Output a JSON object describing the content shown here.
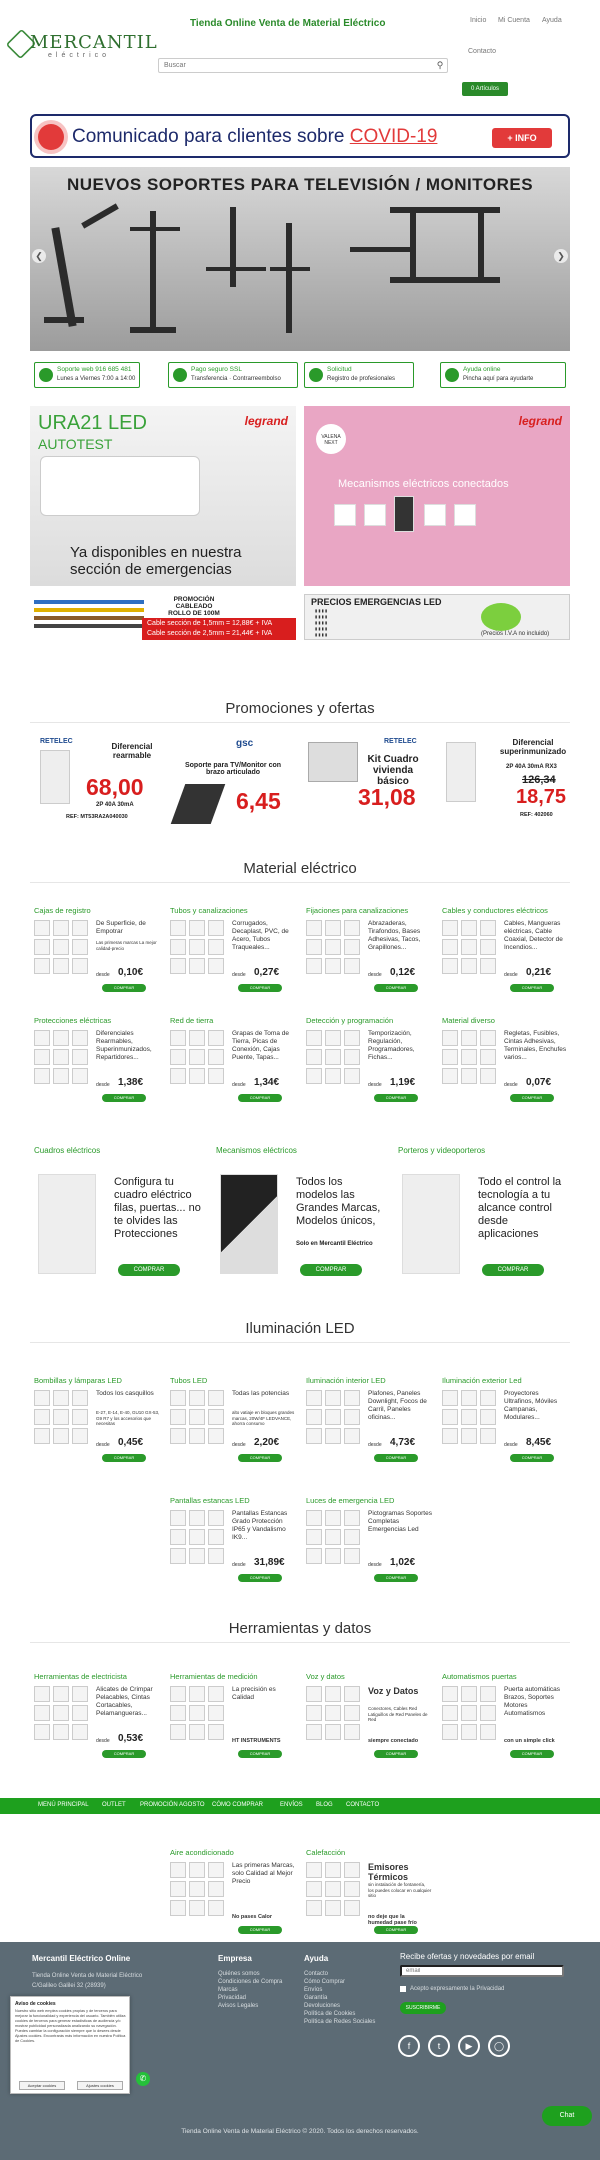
{
  "header": {
    "logo_main": "MERCANTIL",
    "logo_sub": "eléctrico",
    "tagline": "Tienda Online Venta de Material Eléctrico",
    "nav": [
      "Inicio",
      "Mi Cuenta",
      "Ayuda"
    ],
    "contact_link": "Contacto",
    "search_placeholder": "Buscar",
    "cart_label": "0 Artículos"
  },
  "covid_banner": {
    "text_a": "Comunicado para clientes sobre ",
    "text_b": "COVID-19",
    "button": "+ INFO"
  },
  "hero": {
    "title": "NUEVOS SOPORTES PARA TELEVISIÓN / MONITORES"
  },
  "features": [
    {
      "l1": "Soporte web  916 685 481",
      "l2": "Lunes a Viernes  7:00 a 14:00"
    },
    {
      "l1": "Pago seguro SSL",
      "l2": "Transferencia · Contrarreembolso"
    },
    {
      "l1": "Solicitud",
      "l2": "Registro de profesionales"
    },
    {
      "l1": "Ayuda online",
      "l2": "Pincha aquí para ayudarte"
    }
  ],
  "banners": {
    "ura": {
      "title": "URA21 LED",
      "sub": "AUTOTEST",
      "brand": "legrand",
      "bottom": "Ya disponibles en nuestra sección de emergencias"
    },
    "valena": {
      "brand": "legrand",
      "badge": "VALENA NEXT",
      "text": "Mecanismos eléctricos conectados"
    },
    "cable": {
      "title": "PROMOCIÓN CABLEADO ROLLO DE 100M",
      "line1": "Cable sección de 1,5mm = 12,88€ + IVA",
      "line2": "Cable sección de 2,5mm = 21,44€ + IVA"
    },
    "emerg": {
      "title": "PRECIOS EMERGENCIAS LED",
      "note": "(Precios I.V.A no incluido)"
    }
  },
  "sections": {
    "promos": "Promociones y ofertas",
    "material": "Material eléctrico",
    "iluminacion": "Iluminación LED",
    "herramientas": "Herramientas y datos"
  },
  "promos": [
    {
      "brand": "RETELEC",
      "head": "Diferencial rearmable",
      "price": "68,00",
      "sub": "2P 40A 30mA",
      "ref": "REF: MT53RA2A040030"
    },
    {
      "brand": "gsc",
      "head": "Soporte para TV/Monitor con brazo articulado",
      "price": "6,45"
    },
    {
      "brand": "RETELEC",
      "head": "Kit Cuadro vivienda básico",
      "price": "31,08"
    },
    {
      "brand": "",
      "head": "Diferencial superinmunizado",
      "sub": "2P 40A 30mA RX3",
      "old": "126,34",
      "price": "18,75",
      "ref": "REF: 402060"
    }
  ],
  "material": [
    {
      "title": "Cajas de registro",
      "desc": "De Superficie, de Empotrar",
      "sub": "Las primeras marcas La mejor calidad-precio",
      "price": "0,10€"
    },
    {
      "title": "Tubos y canalizaciones",
      "desc": "Corrugados, Decaplast, PVC, de Acero, Tubos Traqueales...",
      "price": "0,27€"
    },
    {
      "title": "Fijaciones para canalizaciones",
      "desc": "Abrazaderas, Tirafondos, Bases Adhesivas, Tacos, Grapillones...",
      "price": "0,12€"
    },
    {
      "title": "Cables y conductores eléctricos",
      "desc": "Cables, Mangueras eléctricas, Cable Coaxial, Detector de Incendios...",
      "price": "0,21€"
    },
    {
      "title": "Protecciones eléctricas",
      "desc": "Diferenciales Rearmables, Superinmunizados, Repartidores...",
      "price": "1,38€"
    },
    {
      "title": "Red de tierra",
      "desc": "Grapas de Toma de Tierra, Picas de Conexión, Cajas Puente, Tapas...",
      "price": "1,34€"
    },
    {
      "title": "Detección y programación",
      "desc": "Temporización, Regulación, Programadores, Fichas...",
      "price": "1,19€"
    },
    {
      "title": "Material diverso",
      "desc": "Regletas, Fusibles, Cintas Adhesivas, Terminales, Enchufes varios...",
      "price": "0,07€"
    }
  ],
  "big_cards": [
    {
      "title": "Cuadros eléctricos",
      "desc": "Configura tu cuadro eléctrico filas, puertas... no te olvides las Protecciones"
    },
    {
      "title": "Mecanismos eléctricos",
      "desc": "Todos los modelos las Grandes Marcas, Modelos únicos,",
      "note": "Solo en Mercantil Eléctrico"
    },
    {
      "title": "Porteros y videoporteros",
      "desc": "Todo el control la tecnología a tu alcance control desde aplicaciones"
    }
  ],
  "iluminacion": [
    {
      "title": "Bombillas y lámparas LED",
      "desc": "Todos los casquillos",
      "sub": "E-27, E-14, E-40, GU10 GX-53, G9 R7 y los accesorios que necesitas",
      "price": "0,45€"
    },
    {
      "title": "Tubos LED",
      "desc": "Todas las potencias",
      "sub": "alto vatiaje en bloques grandes marcas, 20W/4F LEDVANCE, ahorra consumo",
      "price": "2,20€"
    },
    {
      "title": "Iluminación interior LED",
      "desc": "Plafones, Paneles Downlight, Focos de Carril, Paneles oficinas...",
      "price": "4,73€"
    },
    {
      "title": "Iluminación exterior Led",
      "desc": "Proyectores Ultrafinos, Móviles Campanas, Modulares...",
      "price": "8,45€"
    },
    {
      "title": "Pantallas estancas LED",
      "desc": "Pantallas Estancas Grado Protección IP65 y Vandalismo IK9...",
      "price": "31,89€"
    },
    {
      "title": "Luces de emergencia LED",
      "desc": "Pictogramas Soportes Completas Emergencias Led",
      "price": "1,02€"
    }
  ],
  "herramientas": [
    {
      "title": "Herramientas de electricista",
      "desc": "Alicates de Crimpar Pelacables, Cintas Cortacables, Pelamangueras...",
      "price": "0,53€"
    },
    {
      "title": "Herramientas de medición",
      "desc": "La precisión es Calidad",
      "note": "HT INSTRUMENTS",
      "price": ""
    },
    {
      "title": "Voz y datos",
      "desc": "Voz y Datos",
      "sub": "Conectores, Cables Red Latiguillos de Red Paneles de Red",
      "note": "siempre conectado"
    },
    {
      "title": "Automatismos puertas",
      "desc": "Puerta automáticas Brazos, Soportes Motores Automatismos",
      "note": "con un simple click"
    }
  ],
  "menu": [
    "MENÚ PRINCIPAL",
    "OUTLET",
    "PROMOCIÓN AGOSTO",
    "CÓMO COMPRAR",
    "ENVÍOS",
    "BLOG",
    "CONTACTO"
  ],
  "extras": [
    {
      "title": "Aire acondicionado",
      "desc": "Las primeras Marcas, solo Calidad al Mejor Precio",
      "note": "No pases Calor"
    },
    {
      "title": "Calefacción",
      "desc": "Emisores Térmicos",
      "sub": "sin instalación de fontanería, los puedes colocar en cualquier sitio",
      "note": "no deje que la humedad pase frío"
    }
  ],
  "common": {
    "desde": "desde",
    "buy": "COMPRAR"
  },
  "footer": {
    "company": "Mercantil Eléctrico Online",
    "company_lines": [
      "Tienda Online Venta de Material Eléctrico",
      "C/Galileo Galilei 32 (28939)"
    ],
    "empresa_title": "Empresa",
    "empresa": [
      "Quiénes somos",
      "Condiciones de Compra",
      "Marcas",
      "Privacidad",
      "Avisos Legales"
    ],
    "ayuda_title": "Ayuda",
    "ayuda": [
      "Contacto",
      "Cómo Comprar",
      "Envíos",
      "Garantía",
      "Devoluciones",
      "Política de Cookies",
      "Política de Redes Sociales"
    ],
    "newsletter_title": "Recibe ofertas y novedades por email",
    "email_placeholder": "email",
    "accept": "Acepto expresamente la Privacidad",
    "subscribe": "SUSCRIBIRME",
    "copyright": "Tienda Online Venta de Material Eléctrico © 2020. Todos los derechos reservados."
  },
  "cookie": {
    "title": "Aviso de cookies",
    "body": "Nuestro sitio web emplea cookies propias y de terceros para mejorar la funcionalidad y experiencia del usuario. También utiliza cookies de terceros para generar estadísticas de audiencia y/o mostrar publicidad personalizada analizando su navegación. Puedes cambiar la configuración siempre que lo desees desde Ajustes cookies. Encontrarás más información en nuestra Política de Cookies.",
    "accept": "Aceptar cookies",
    "settings": "Ajustes cookies"
  },
  "chat": "Chat",
  "colors": {
    "green": "#2a9a2a",
    "red": "#d81e1e",
    "navy": "#1d2a6b",
    "footer": "#5c6b75"
  }
}
